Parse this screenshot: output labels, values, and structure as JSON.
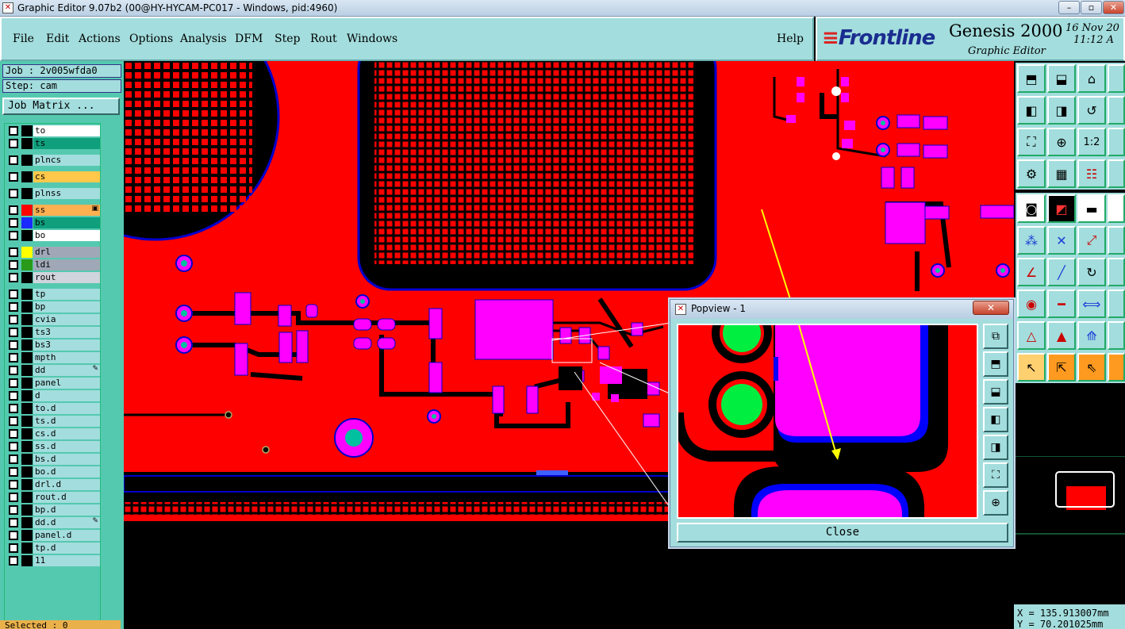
{
  "window": {
    "title": "Graphic Editor 9.07b2 (00@HY-HYCAM-PC017 - Windows, pid:4960)",
    "app_icon": "x-icon",
    "controls": [
      "minimize-icon",
      "maximize-icon",
      "close-icon"
    ]
  },
  "menu": {
    "items": [
      "File",
      "Edit",
      "Actions",
      "Options",
      "Analysis",
      "DFM",
      "Step",
      "Rout",
      "Windows"
    ],
    "help": "Help"
  },
  "brand": {
    "logo_prefix": "≡",
    "logo": "Frontline",
    "product": "Genesis 2000",
    "subtitle": "Graphic Editor",
    "date": "16 Nov 20",
    "time": "11:12 A"
  },
  "job": {
    "job_line": "Job : 2v005wfda0",
    "step_line": "Step: cam",
    "matrix_button": "Job Matrix ..."
  },
  "layers": [
    {
      "name": "to",
      "swatch": "#000000",
      "bg": "#ffffff"
    },
    {
      "name": "ts",
      "swatch": "#000000",
      "bg": "#0f9f7d"
    },
    {
      "name": "plncs",
      "swatch": "#000000",
      "bg": "#a3dddd"
    },
    {
      "name": "cs",
      "swatch": "#000000",
      "bg": "#ffc84a"
    },
    {
      "name": "plnss",
      "swatch": "#000000",
      "bg": "#a3dddd"
    },
    {
      "name": "ss",
      "swatch": "#ff0000",
      "bg": "#ffb050",
      "mark": "▣"
    },
    {
      "name": "bs",
      "swatch": "#1a2bff",
      "bg": "#0f9f7d"
    },
    {
      "name": "bo",
      "swatch": "#000000",
      "bg": "#ffffff"
    },
    {
      "name": "drl",
      "swatch": "#ffff00",
      "bg": "#a0a8b8"
    },
    {
      "name": "ldi",
      "swatch": "#2a9a1a",
      "bg": "#a0a8b8"
    },
    {
      "name": "rout",
      "swatch": "#000000",
      "bg": "#d0d4dc"
    },
    {
      "name": "tp",
      "swatch": "#000000",
      "bg": "#a3dddd"
    },
    {
      "name": "bp",
      "swatch": "#000000",
      "bg": "#a3dddd"
    },
    {
      "name": "cvia",
      "swatch": "#000000",
      "bg": "#a3dddd"
    },
    {
      "name": "ts3",
      "swatch": "#000000",
      "bg": "#a3dddd"
    },
    {
      "name": "bs3",
      "swatch": "#000000",
      "bg": "#a3dddd"
    },
    {
      "name": "mpth",
      "swatch": "#000000",
      "bg": "#a3dddd"
    },
    {
      "name": "dd",
      "swatch": "#000000",
      "bg": "#a3dddd",
      "mark": "✎"
    },
    {
      "name": "panel",
      "swatch": "#000000",
      "bg": "#a3dddd"
    },
    {
      "name": "d",
      "swatch": "#000000",
      "bg": "#a3dddd"
    },
    {
      "name": "to.d",
      "swatch": "#000000",
      "bg": "#a3dddd"
    },
    {
      "name": "ts.d",
      "swatch": "#000000",
      "bg": "#a3dddd"
    },
    {
      "name": "cs.d",
      "swatch": "#000000",
      "bg": "#a3dddd"
    },
    {
      "name": "ss.d",
      "swatch": "#000000",
      "bg": "#a3dddd"
    },
    {
      "name": "bs.d",
      "swatch": "#000000",
      "bg": "#a3dddd"
    },
    {
      "name": "bo.d",
      "swatch": "#000000",
      "bg": "#a3dddd"
    },
    {
      "name": "drl.d",
      "swatch": "#000000",
      "bg": "#a3dddd"
    },
    {
      "name": "rout.d",
      "swatch": "#000000",
      "bg": "#a3dddd"
    },
    {
      "name": "bp.d",
      "swatch": "#000000",
      "bg": "#a3dddd"
    },
    {
      "name": "dd.d",
      "swatch": "#000000",
      "bg": "#a3dddd",
      "mark": "✎"
    },
    {
      "name": "panel.d",
      "swatch": "#000000",
      "bg": "#a3dddd"
    },
    {
      "name": "tp.d",
      "swatch": "#000000",
      "bg": "#a3dddd"
    },
    {
      "name": "11",
      "swatch": "#000000",
      "bg": "#a3dddd"
    }
  ],
  "status": {
    "selected": "Selected : 0"
  },
  "coords": {
    "x": "X = 135.913007mm",
    "y": "Y = 70.201025mm"
  },
  "popview": {
    "title": "Popview - 1",
    "close_x": "✕",
    "close_label": "Close",
    "tools": [
      "zoom-window-icon",
      "pan-up-icon",
      "pan-down-icon",
      "pan-left-icon",
      "pan-right-icon",
      "fit-icon",
      "zoom-icon"
    ]
  },
  "colors": {
    "copper": "#ff0000",
    "pad": "#ff00ff",
    "drill": "#00ff40",
    "outline": "#0000cc",
    "panel": "#a3dddd",
    "arrow": "#ffff00"
  }
}
